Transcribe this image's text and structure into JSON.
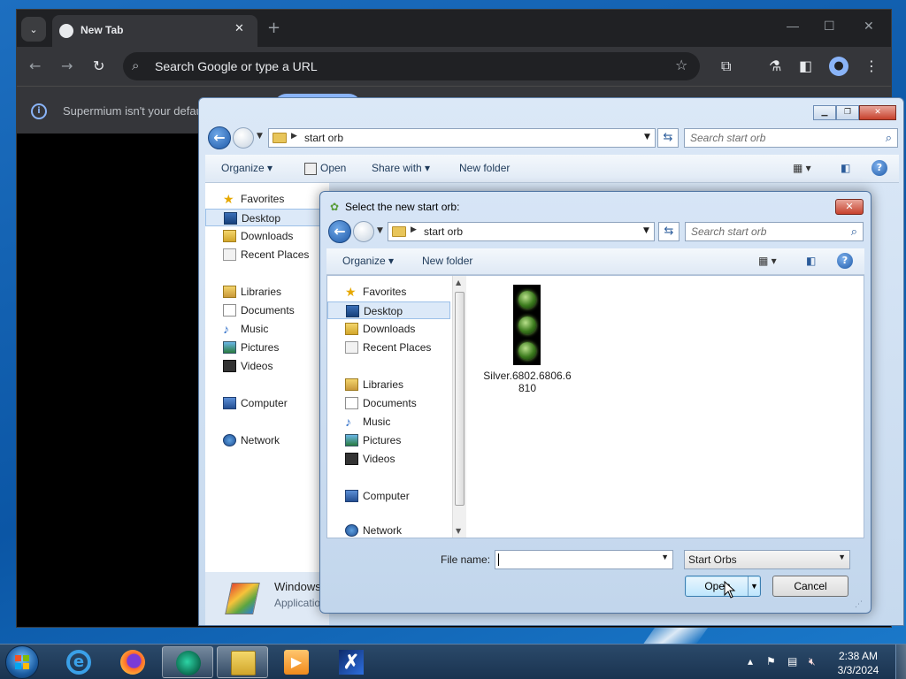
{
  "chrome": {
    "tab_title": "New Tab",
    "tab_close": "✕",
    "new_tab": "+",
    "omnibox_placeholder": "Search Google or type a URL",
    "infobar_text": "Supermium isn't your defau"
  },
  "explorer": {
    "path": "start orb",
    "search_placeholder": "Search start orb",
    "commands": {
      "organize": "Organize ▾",
      "open": "Open",
      "share": "Share with ▾",
      "new_folder": "New folder"
    },
    "nav": {
      "favorites": "Favorites",
      "desktop": "Desktop",
      "downloads": "Downloads",
      "recent": "Recent Places",
      "libraries": "Libraries",
      "documents": "Documents",
      "music": "Music",
      "pictures": "Pictures",
      "videos": "Videos",
      "computer": "Computer",
      "network": "Network"
    },
    "status_name": "Windows",
    "status_type": "Applicatio"
  },
  "dialog": {
    "title": "Select the new start orb:",
    "path": "start orb",
    "search_placeholder": "Search start orb",
    "commands": {
      "organize": "Organize ▾",
      "new_folder": "New folder"
    },
    "nav": {
      "favorites": "Favorites",
      "desktop": "Desktop",
      "downloads": "Downloads",
      "recent": "Recent Places",
      "libraries": "Libraries",
      "documents": "Documents",
      "music": "Music",
      "pictures": "Pictures",
      "videos": "Videos",
      "computer": "Computer",
      "network": "Network"
    },
    "file_name": "Silver.6802.6806.6810",
    "file_name_label": "File name:",
    "file_name_value": "",
    "file_type": "Start Orbs",
    "open_label": "Open",
    "cancel_label": "Cancel"
  },
  "taskbar": {
    "time": "2:38 AM",
    "date": "3/3/2024"
  },
  "colors": {
    "accent": "#8ab4f8",
    "taskbar": "#1a3350"
  }
}
